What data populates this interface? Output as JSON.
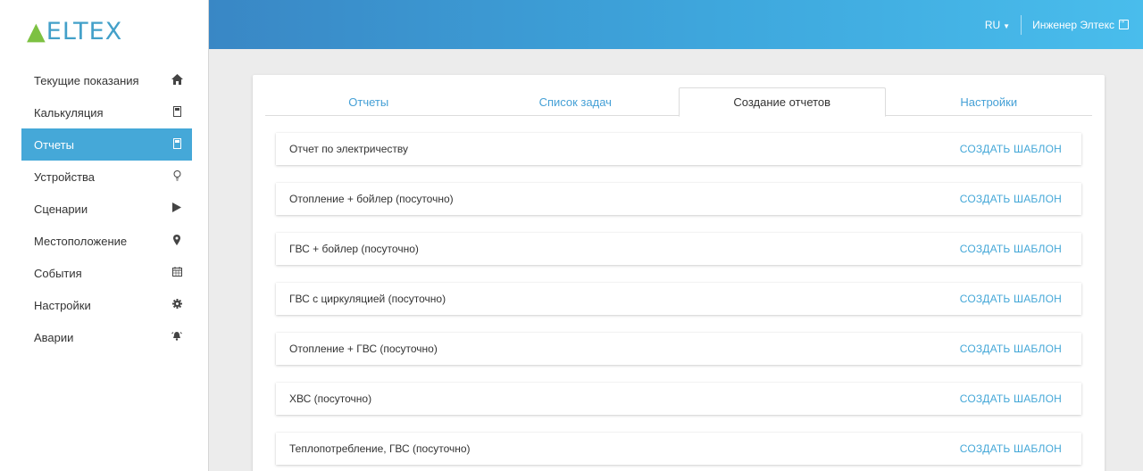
{
  "brand": {
    "logo_text": "ELTEX"
  },
  "header": {
    "language": "RU",
    "user_name": "Инженер Элтекс"
  },
  "sidebar": {
    "items": [
      {
        "label": "Текущие показания",
        "icon": "home-icon"
      },
      {
        "label": "Калькуляция",
        "icon": "calculator-icon"
      },
      {
        "label": "Отчеты",
        "icon": "report-icon",
        "active": true
      },
      {
        "label": "Устройства",
        "icon": "lightbulb-icon"
      },
      {
        "label": "Сценарии",
        "icon": "play-icon"
      },
      {
        "label": "Местоположение",
        "icon": "map-marker-icon"
      },
      {
        "label": "События",
        "icon": "calendar-icon"
      },
      {
        "label": "Настройки",
        "icon": "gear-icon"
      },
      {
        "label": "Аварии",
        "icon": "alarm-bell-icon"
      }
    ]
  },
  "tabs": [
    {
      "label": "Отчеты"
    },
    {
      "label": "Список задач"
    },
    {
      "label": "Создание отчетов",
      "active": true
    },
    {
      "label": "Настройки"
    }
  ],
  "reports": {
    "create_label": "СОЗДАТЬ ШАБЛОН",
    "items": [
      "Отчет по электричеству",
      "Отопление + бойлер (посуточно)",
      "ГВС + бойлер (посуточно)",
      "ГВС с циркуляцией (посуточно)",
      "Отопление + ГВС (посуточно)",
      "ХВС (посуточно)",
      "Теплопотребление, ГВС (посуточно)"
    ]
  },
  "colors": {
    "accent": "#45a8d8",
    "topbar_start": "#3987c5",
    "topbar_end": "#49bdec",
    "logo_green": "#7dc142"
  }
}
